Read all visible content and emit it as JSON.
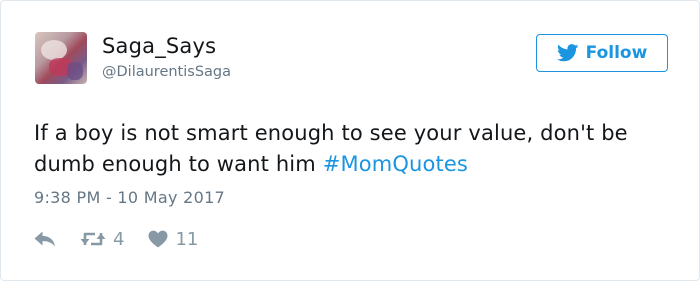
{
  "user": {
    "display_name": "Saga_Says",
    "handle": "@DilaurentisSaga"
  },
  "follow": {
    "label": "Follow",
    "icon": "twitter-bird-icon",
    "color": "#1b95e0"
  },
  "tweet": {
    "text": "If a boy is not smart enough to see your value, don't be dumb enough to want him",
    "hashtag": "#MomQuotes",
    "timestamp": "9:38 PM - 10 May 2017"
  },
  "actions": {
    "reply_icon": "reply-icon",
    "retweet_icon": "retweet-icon",
    "retweet_count": "4",
    "like_icon": "heart-icon",
    "like_count": "11"
  }
}
